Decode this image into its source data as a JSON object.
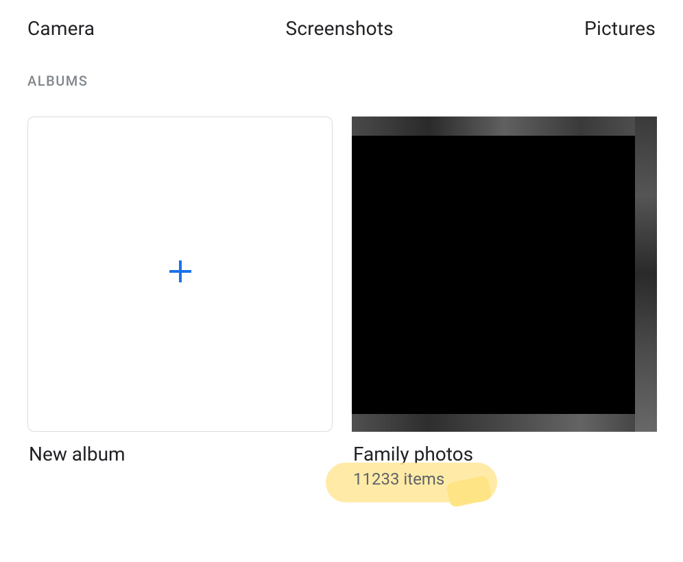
{
  "categories": {
    "items": [
      {
        "label": "Camera"
      },
      {
        "label": "Screenshots"
      },
      {
        "label": "Pictures"
      }
    ]
  },
  "section": {
    "header": "ALBUMS"
  },
  "albums": {
    "new": {
      "title": "New album"
    },
    "family": {
      "title": "Family photos",
      "count": "11233 items"
    }
  }
}
